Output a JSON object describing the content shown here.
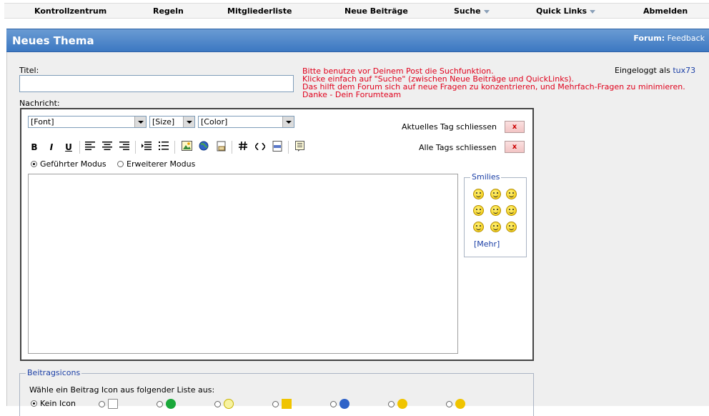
{
  "nav": {
    "items": [
      {
        "label": "Kontrollzentrum",
        "caret": false
      },
      {
        "label": "Regeln",
        "caret": false
      },
      {
        "label": "Mitgliederliste",
        "caret": false
      },
      {
        "label": "Neue Beiträge",
        "caret": false
      },
      {
        "label": "Suche",
        "caret": true
      },
      {
        "label": "Quick Links",
        "caret": true
      },
      {
        "label": "Abmelden",
        "caret": false
      }
    ]
  },
  "header": {
    "title": "Neues Thema",
    "forum_label": "Forum:",
    "forum_name": "Feedback"
  },
  "form": {
    "title_label": "Titel:",
    "title_value": "",
    "message_label": "Nachricht:",
    "notice": [
      "Bitte benutze vor Deinem Post die Suchfunktion.",
      "Klicke einfach auf \"Suche\" (zwischen Neue Beiträge und QuickLinks).",
      "Das hilft dem Forum sich auf neue Fragen zu konzentrieren, und Mehrfach-Fragen zu minimieren.",
      "Danke - Dein Forumteam"
    ],
    "logged_in_prefix": "Eingeloggt als",
    "username": "tux73"
  },
  "editor": {
    "font_select": "[Font]",
    "size_select": "[Size]",
    "color_select": "[Color]",
    "close_current_tag": "Aktuelles Tag schliessen",
    "close_all_tags": "Alle Tags schliessen",
    "close_button": "x",
    "mode_guided": "Geführter Modus",
    "mode_extended": "Erweiterer Modus",
    "toolbar": [
      "B",
      "I",
      "U"
    ]
  },
  "smilies": {
    "legend": "Smilies",
    "more": "[Mehr]"
  },
  "post_icons": {
    "legend": "Beitragsicons",
    "description": "Wähle ein Beitrag Icon aus folgender Liste aus:",
    "no_icon": "Kein Icon"
  },
  "colors": {
    "header_blue": "#3c78c2",
    "notice_red": "#e0001b",
    "link_blue": "#1b3fa6"
  }
}
